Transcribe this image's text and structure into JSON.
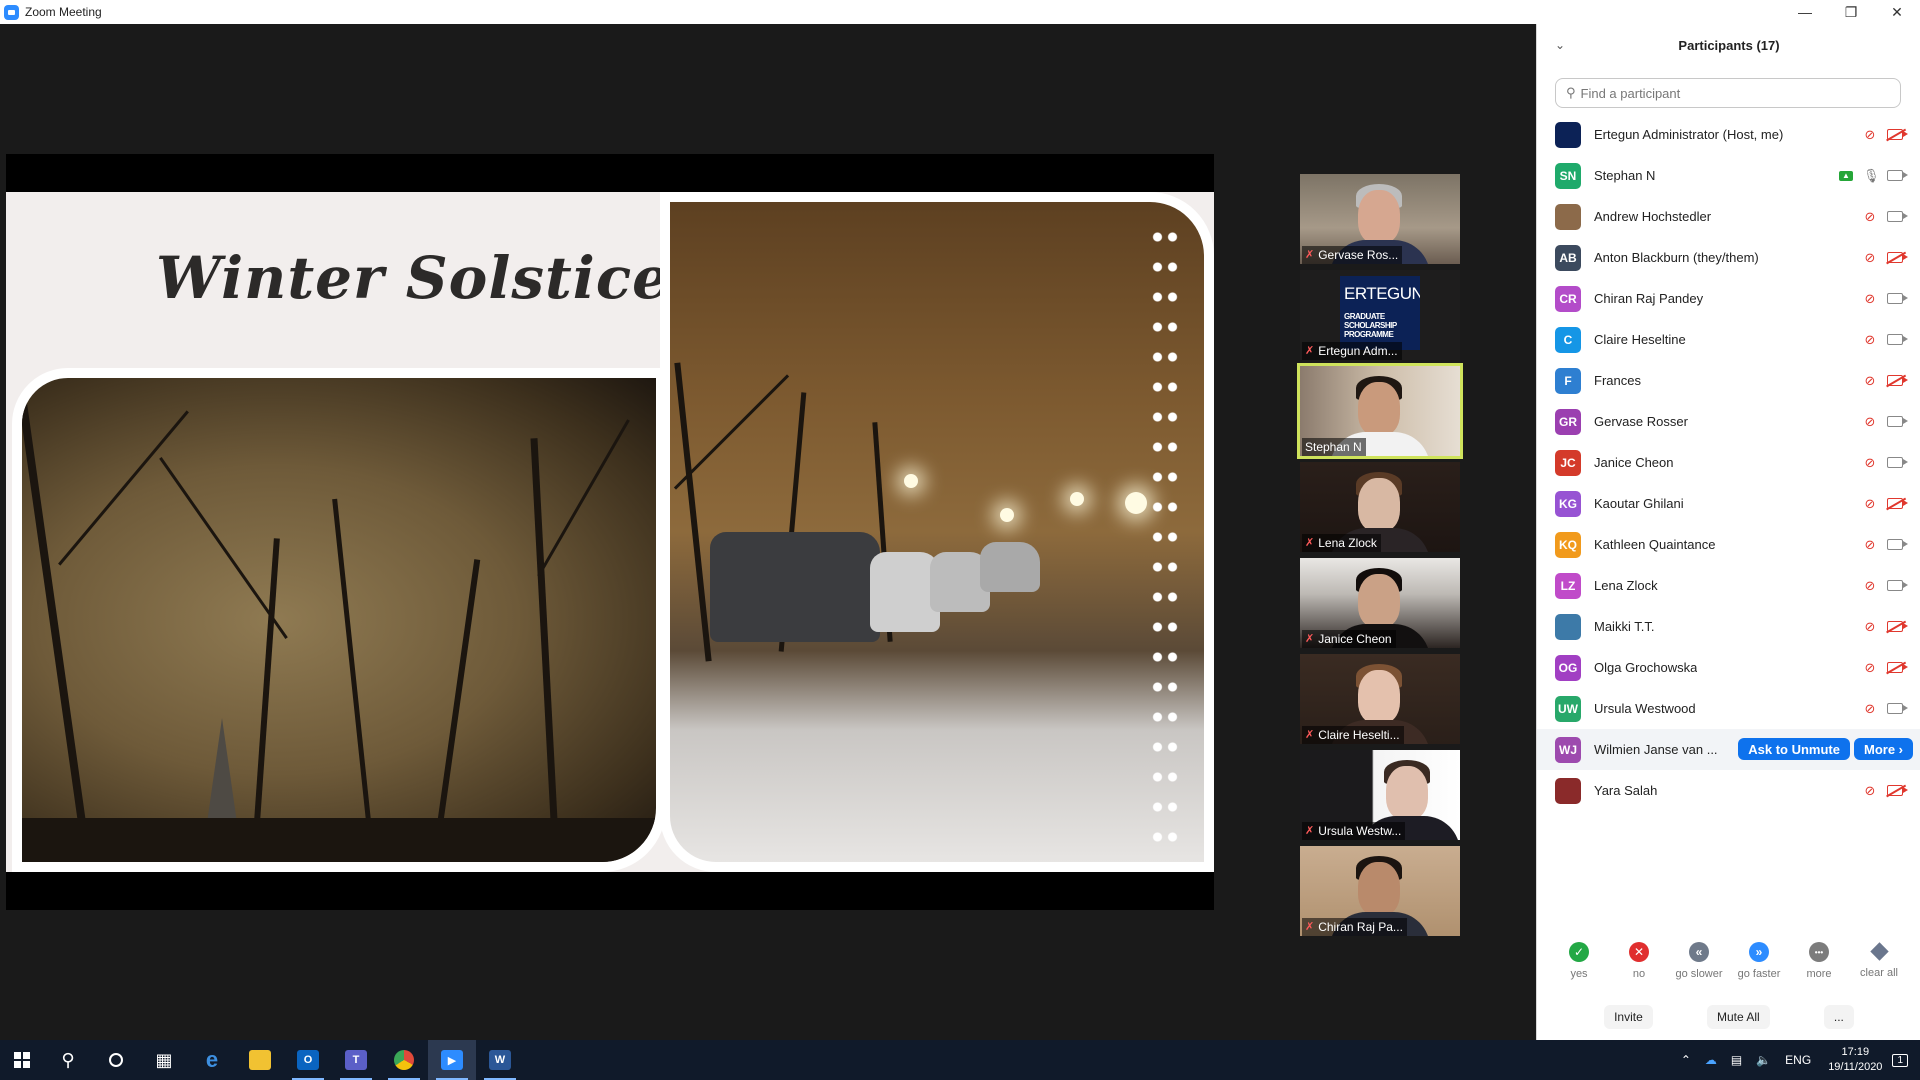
{
  "window": {
    "title": "Zoom Meeting"
  },
  "slide": {
    "title": "Winter Solstice"
  },
  "thumbnails": [
    {
      "name": "Gervase Ros..."
    },
    {
      "name": "Ertegun Adm...",
      "logo_text": "ERTEGUN",
      "logo_sub": [
        "GRADUATE",
        "SCHOLARSHIP",
        "PROGRAMME"
      ]
    },
    {
      "name": "Stephan N"
    },
    {
      "name": "Lena Zlock"
    },
    {
      "name": "Janice Cheon"
    },
    {
      "name": "Claire Heselti..."
    },
    {
      "name": "Ursula Westw..."
    },
    {
      "name": "Chiran Raj Pa..."
    }
  ],
  "panel": {
    "title": "Participants (17)",
    "search_placeholder": "Find a participant",
    "participants": [
      {
        "name": "Ertegun Administrator (Host, me)",
        "initials": "",
        "color": "#0c2256"
      },
      {
        "name": "Stephan N",
        "initials": "SN",
        "color": "#1faa6b"
      },
      {
        "name": "Andrew Hochstedler",
        "initials": "",
        "color": "#8c6a4a"
      },
      {
        "name": "Anton Blackburn (they/them)",
        "initials": "AB",
        "color": "#3c4a5e"
      },
      {
        "name": "Chiran Raj Pandey",
        "initials": "CR",
        "color": "#b34cc9"
      },
      {
        "name": "Claire Heseltine",
        "initials": "C",
        "color": "#1596e6"
      },
      {
        "name": "Frances",
        "initials": "F",
        "color": "#2e7fd1"
      },
      {
        "name": "Gervase Rosser",
        "initials": "GR",
        "color": "#9b3fb0"
      },
      {
        "name": "Janice Cheon",
        "initials": "JC",
        "color": "#d43a2a"
      },
      {
        "name": "Kaoutar Ghilani",
        "initials": "KG",
        "color": "#9753d3"
      },
      {
        "name": "Kathleen Quaintance",
        "initials": "KQ",
        "color": "#f19a1c"
      },
      {
        "name": "Lena Zlock",
        "initials": "LZ",
        "color": "#c04bc9"
      },
      {
        "name": "Maikki T.T.",
        "initials": "",
        "color": "#3d7aa8"
      },
      {
        "name": "Olga Grochowska",
        "initials": "OG",
        "color": "#a13fc3"
      },
      {
        "name": "Ursula Westwood",
        "initials": "UW",
        "color": "#28a86a"
      },
      {
        "name": "Wilmien Janse van ...",
        "initials": "WJ",
        "color": "#9d4aae"
      },
      {
        "name": "Yara Salah",
        "initials": "",
        "color": "#8a2a2a"
      }
    ],
    "ask_to_unmute": "Ask to Unmute",
    "more": "More ›",
    "reactions": [
      {
        "label": "yes",
        "symbol": "✓",
        "color": "#23a845"
      },
      {
        "label": "no",
        "symbol": "✕",
        "color": "#e02f2f"
      },
      {
        "label": "go slower",
        "symbol": "«",
        "color": "#6f7a8a"
      },
      {
        "label": "go faster",
        "symbol": "»",
        "color": "#2d8cff"
      },
      {
        "label": "more",
        "symbol": "•••",
        "color": "#7c7c7c"
      },
      {
        "label": "clear all",
        "symbol": "",
        "color": "#6a768d"
      }
    ],
    "footer": {
      "invite": "Invite",
      "mute_all": "Mute All",
      "more": "..."
    }
  },
  "taskbar": {
    "language": "ENG",
    "time": "17:19",
    "date": "19/11/2020",
    "notifications": "1"
  },
  "icons": {
    "start": "windows-start-icon",
    "search": "search-icon",
    "cortana": "cortana-icon",
    "taskview": "task-view-icon"
  }
}
